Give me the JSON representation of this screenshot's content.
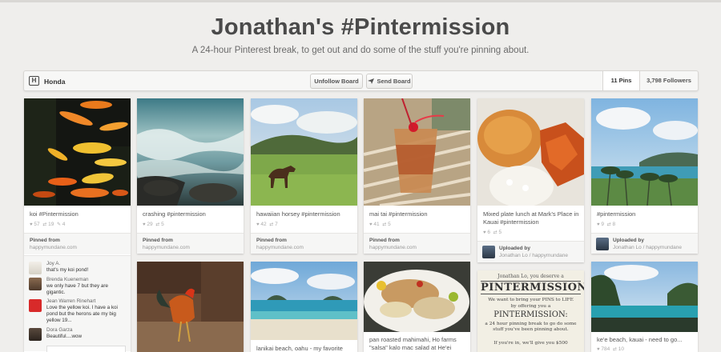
{
  "board": {
    "title": "Jonathan's #Pintermission",
    "subtitle": "A 24-hour Pinterest break, to get out and do some of the stuff you're pinning about."
  },
  "toolbar": {
    "owner_name": "Honda",
    "logo_letter": "H",
    "unfollow_label": "Unfollow Board",
    "send_label": "Send Board",
    "pins_count": "11 Pins",
    "followers_count": "3,798 Followers"
  },
  "pins": [
    {
      "desc": "koi #Pintermission",
      "likes": "57",
      "repins": "19",
      "comments": "4",
      "source_label": "Pinned from",
      "source_domain": "happymundane.com",
      "image": "koi-fish"
    },
    {
      "desc": "crashing #pintermission",
      "likes": "29",
      "repins": "5",
      "source_label": "Pinned from",
      "source_domain": "happymundane.com",
      "image": "crashing-waves"
    },
    {
      "desc": "hawaiian horsey #pintermission",
      "likes": "42",
      "repins": "7",
      "source_label": "Pinned from",
      "source_domain": "happymundane.com",
      "image": "horse-field"
    },
    {
      "desc": "mai tai #pintermission",
      "likes": "41",
      "repins": "5",
      "source_label": "Pinned from",
      "source_domain": "happymundane.com",
      "image": "mai-tai"
    },
    {
      "desc": "Mixed plate lunch at Mark's Place in Kauai #pintermission",
      "likes": "6",
      "repins": "5",
      "upload_label": "Uploaded by",
      "uploader": "Jonathan Lo / happymundane",
      "image": "plate-lunch"
    },
    {
      "desc": "#pintermission",
      "likes": "9",
      "repins": "8",
      "upload_label": "Uploaded by",
      "uploader": "Jonathan Lo / happymundane",
      "image": "beach-palms"
    }
  ],
  "comments": [
    {
      "name": "Joy A.",
      "text": "that's my koi pond!"
    },
    {
      "name": "Brenda Kueneman",
      "text": "we only have 7 but they are gigantic."
    },
    {
      "name": "Jean Warren Rinehart",
      "text": "Love the yellow koi. I have a koi pond but the herons ate my big yellow 19..."
    },
    {
      "name": "Dora Garza",
      "text": "Beautiful....wow"
    }
  ],
  "row2": [
    {
      "image": "rooster"
    },
    {
      "desc": "lanikai beach, oahu - my favorite",
      "image": "lanikai-beach"
    },
    {
      "desc": "pan roasted mahimahi, Ho farms \"salsa\" kalo mac salad at He'ei",
      "image": "mahimahi"
    },
    {
      "image": "pintermission-poster",
      "poster": {
        "byline": "Jonathan Lo, you deserve a",
        "headline": "PINTERMISSION",
        "line1": "We want to bring your PINS to LIFE",
        "line2": "by offering you a",
        "line3": "PINTERMISSION:",
        "line4": "a 24 hour pinning break to go do some stuff you've been pinning about.",
        "line5": "If you're in, we'll give you $500"
      }
    },
    {
      "desc": "ke'e beach, kauai - need to go...",
      "likes": "784",
      "repins": "10",
      "image": "kee-beach"
    }
  ],
  "colors": {
    "background": "#efeeec",
    "title": "#4a4a4a",
    "pin_card": "#ffffff"
  }
}
